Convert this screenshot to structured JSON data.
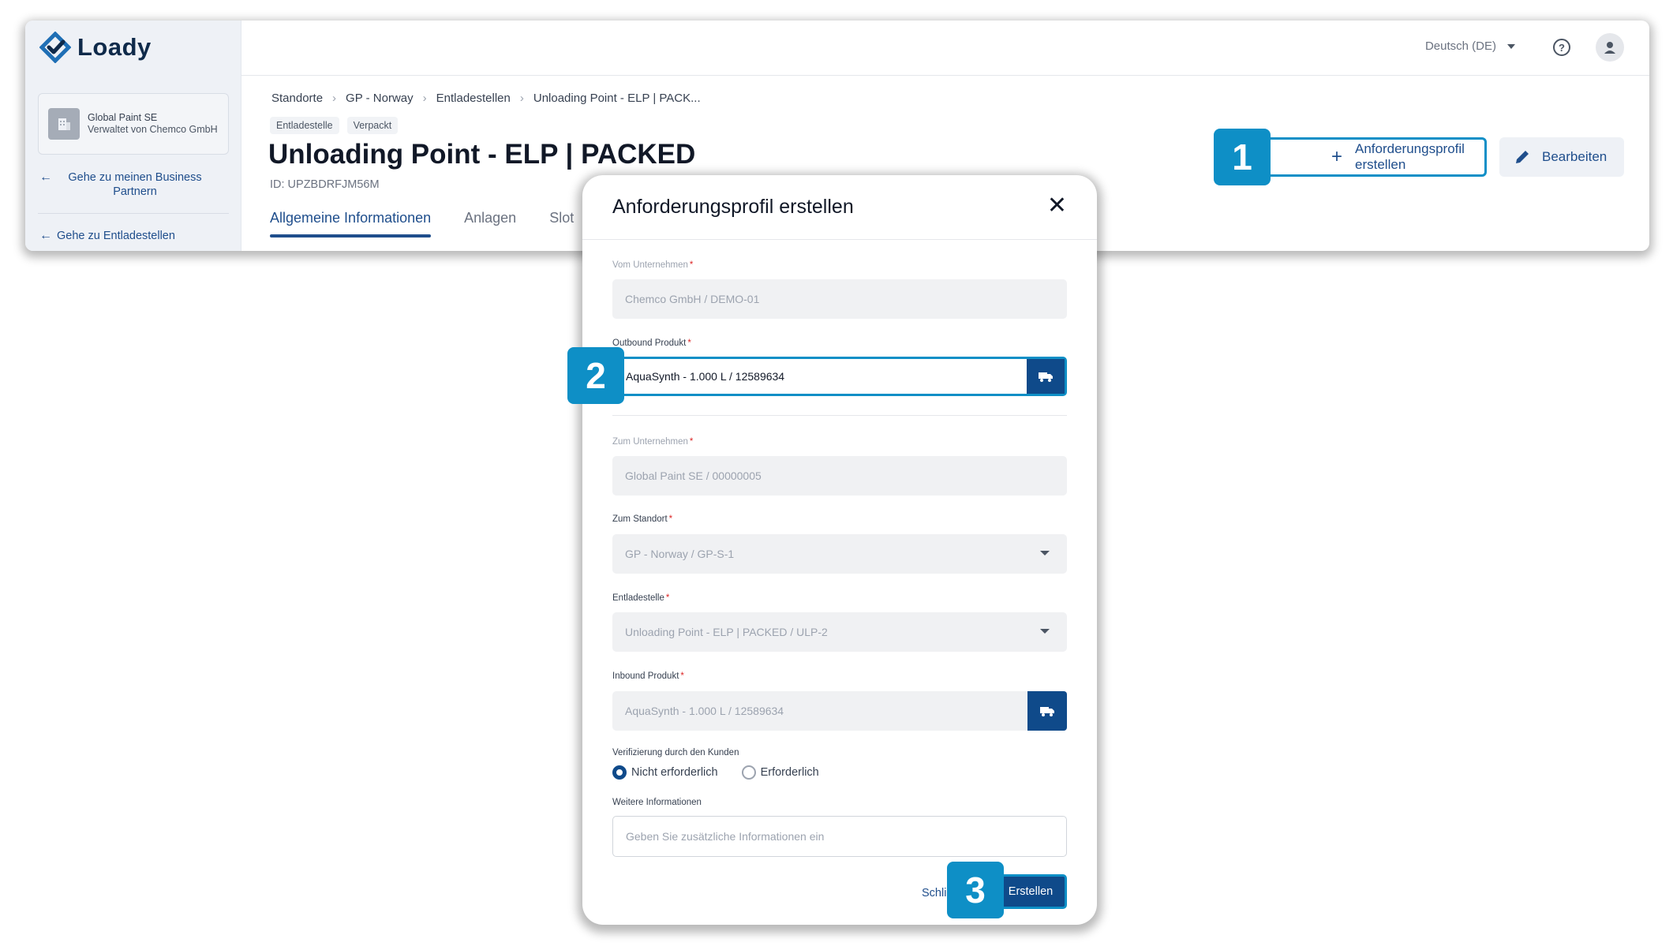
{
  "brand": {
    "name": "Loady"
  },
  "sidebar": {
    "company_name": "Global Paint SE",
    "company_managed": "Verwaltet von Chemco GmbH",
    "link_partners": "Gehe zu meinen Business Partnern",
    "link_unloading": "Gehe zu Entladestellen"
  },
  "topbar": {
    "language": "Deutsch (DE)"
  },
  "breadcrumb": [
    "Standorte",
    "GP - Norway",
    "Entladestellen",
    "Unloading Point - ELP | PACK..."
  ],
  "chips": [
    "Entladestelle",
    "Verpackt"
  ],
  "page": {
    "title": "Unloading Point - ELP | PACKED",
    "id": "ID: UPZBDRFJM56M"
  },
  "tabs": [
    "Allgemeine Informationen",
    "Anlagen",
    "Slot"
  ],
  "actions": {
    "create_profile": "Anforderungsprofil erstellen",
    "edit": "Bearbeiten"
  },
  "steps": [
    "1",
    "2",
    "3"
  ],
  "modal": {
    "title": "Anforderungsprofil erstellen",
    "from_company_label": "Vom Unternehmen",
    "from_company_value": "Chemco GmbH / DEMO-01",
    "outbound_label": "Outbound Produkt",
    "outbound_value": "AquaSynth - 1.000 L / 12589634",
    "to_company_label": "Zum Unternehmen",
    "to_company_value": "Global Paint SE / 00000005",
    "to_site_label": "Zum Standort",
    "to_site_value": "GP - Norway / GP-S-1",
    "unloading_label": "Entladestelle",
    "unloading_value": "Unloading Point - ELP | PACKED / ULP-2",
    "inbound_label": "Inbound Produkt",
    "inbound_value": "AquaSynth - 1.000 L / 12589634",
    "verification_label": "Verifizierung durch den Kunden",
    "verification_options": [
      "Nicht erforderlich",
      "Erforderlich"
    ],
    "verification_selected": "Nicht erforderlich",
    "info_label": "Weitere Informationen",
    "info_placeholder": "Geben Sie zusätzliche Informationen ein",
    "close_label": "Schließen",
    "submit_label": "Erstellen"
  },
  "colors": {
    "primary": "#0f4a8a",
    "accent": "#0e8fc6",
    "link": "#1f4e8c"
  },
  "icons": {
    "logo": "loady-logo-icon",
    "product_search": "truck-search-icon",
    "edit": "pencil-icon",
    "add": "plus-icon"
  }
}
